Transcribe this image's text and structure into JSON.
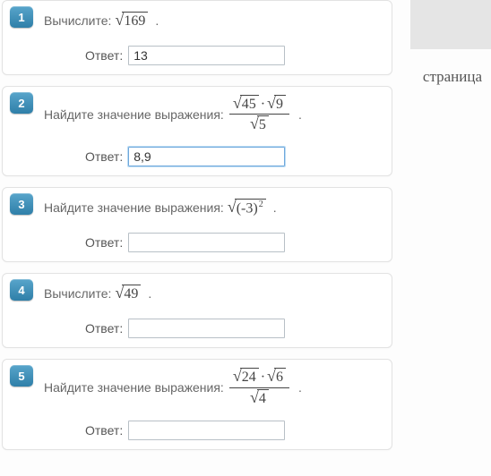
{
  "stray_text": "страница",
  "answer_label": "Ответ:",
  "questions": [
    {
      "num": "1",
      "prompt_prefix": "Вычислите:",
      "math_type": "sqrt-simple",
      "radicand": "169",
      "answer": "13"
    },
    {
      "num": "2",
      "prompt_prefix": "Найдите значение выражения:",
      "math_type": "sqrt-frac",
      "top_a": "45",
      "top_b": "9",
      "bot": "5",
      "answer": "8,9",
      "focused": true
    },
    {
      "num": "3",
      "prompt_prefix": "Найдите значение выражения:",
      "math_type": "sqrt-sq",
      "base": "(-3)",
      "exp": "2",
      "answer": ""
    },
    {
      "num": "4",
      "prompt_prefix": "Вычислите:",
      "math_type": "sqrt-simple",
      "radicand": "49",
      "answer": ""
    },
    {
      "num": "5",
      "prompt_prefix": "Найдите значение выражения:",
      "math_type": "sqrt-frac",
      "top_a": "24",
      "top_b": "6",
      "bot": "4",
      "answer": ""
    }
  ]
}
